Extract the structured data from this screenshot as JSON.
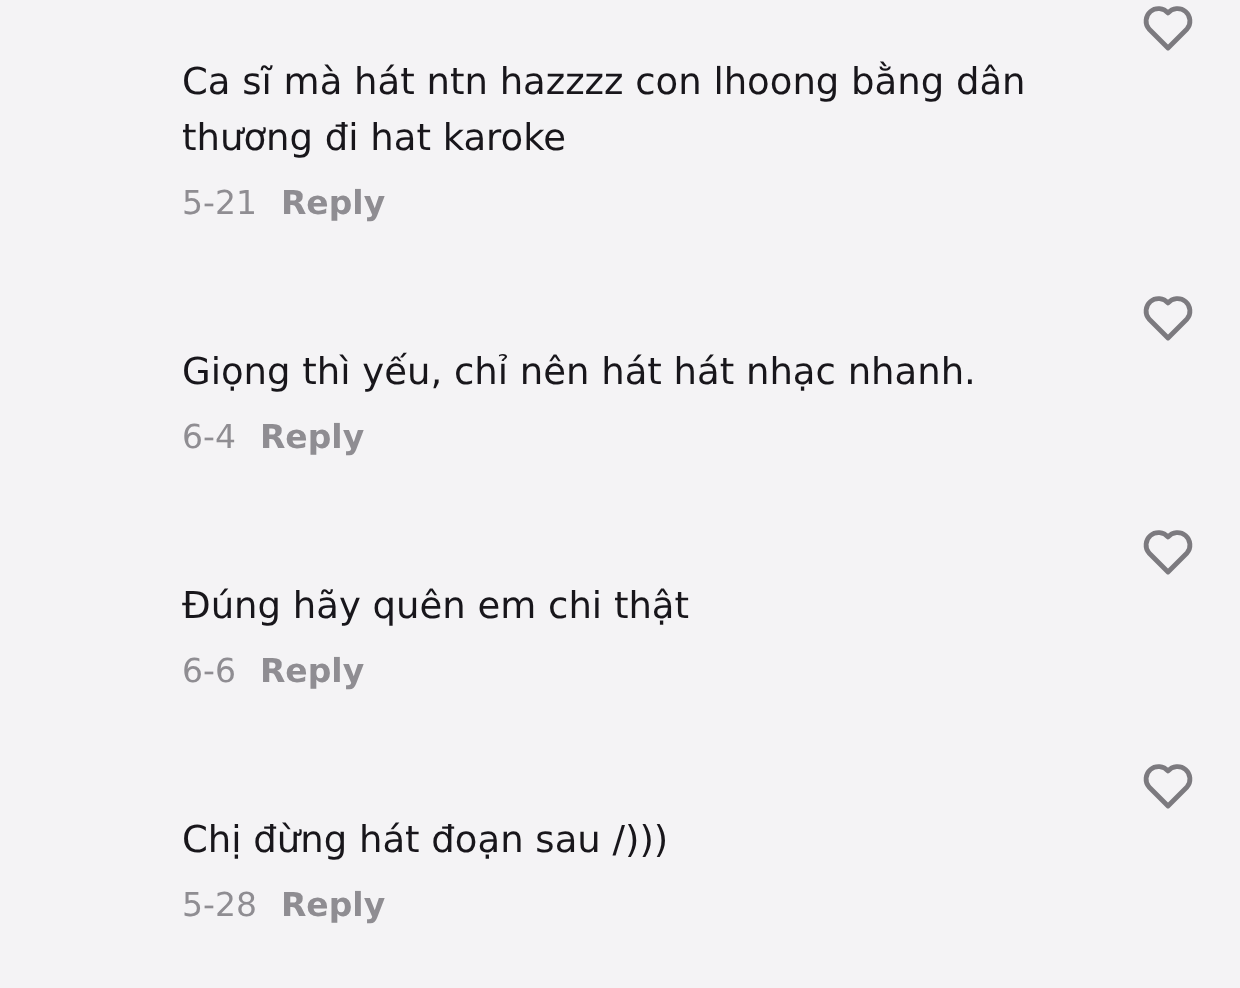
{
  "comments": [
    {
      "text": "Ca sĩ mà hát ntn hazzzz con lhoong bằng dân thương đi hat karoke",
      "date": "5-21",
      "reply": "Reply",
      "liked": false
    },
    {
      "text": "Giọng thì yếu, chỉ nên hát hát nhạc nhanh.",
      "date": "6-4",
      "reply": "Reply",
      "liked": false
    },
    {
      "text": "Đúng hãy quên em chi thật",
      "date": "6-6",
      "reply": "Reply",
      "liked": false
    },
    {
      "text": "Chị đừng hát đoạn sau /)))",
      "date": "5-28",
      "reply": "Reply",
      "liked": false
    }
  ]
}
